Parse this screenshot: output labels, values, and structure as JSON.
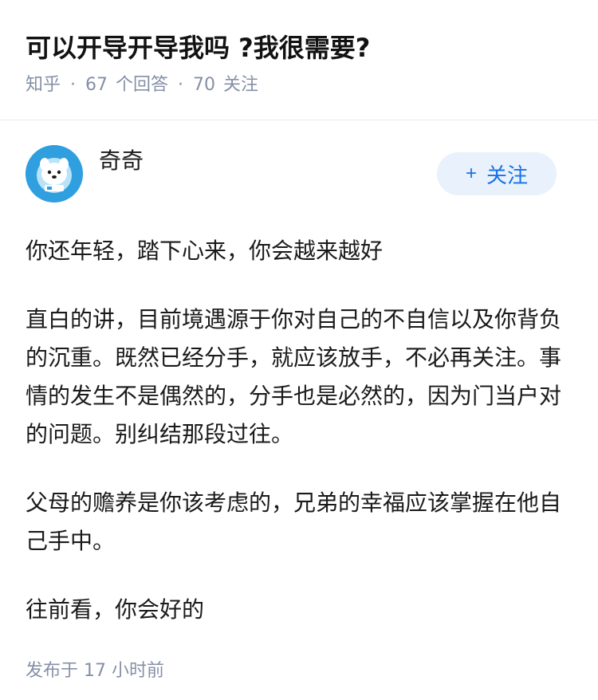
{
  "question": {
    "title": "可以开导开导我吗 ?我很需要?",
    "source": "知乎",
    "answers_count": "67",
    "answers_label": "个回答",
    "followers_count": "70",
    "followers_label": "关注"
  },
  "author": {
    "name": "奇奇",
    "avatar_icon": "avatar-icon",
    "follow_plus": "+",
    "follow_label": "关注"
  },
  "answer": {
    "paragraphs": [
      "你还年轻，踏下心来，你会越来越好",
      "直白的讲，目前境遇源于你对自己的不自信以及你背负的沉重。既然已经分手，就应该放手，不必再关注。事情的发生不是偶然的，分手也是必然的，因为门当户对的问题。别纠结那段过往。",
      "父母的赡养是你该考虑的，兄弟的幸福应该掌握在他自己手中。",
      "往前看，你会好的"
    ],
    "published": "发布于 17 小时前"
  },
  "colors": {
    "accent": "#1772e6",
    "follow_bg": "#e8f1fc",
    "meta": "#8590a6"
  }
}
